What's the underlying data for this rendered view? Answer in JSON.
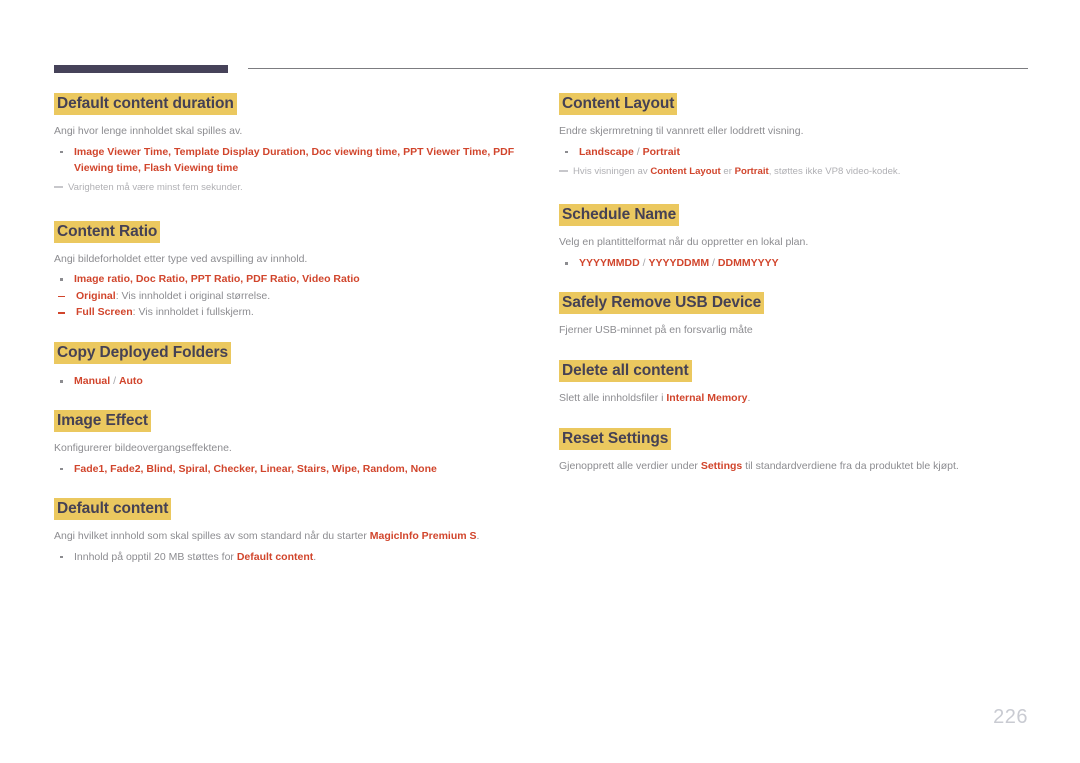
{
  "page": {
    "number": "226"
  },
  "left_column": [
    {
      "heading": "Default content duration",
      "desc": "Angi hvor lenge innholdet skal spilles av.",
      "bullet": {
        "prefix": "Image Viewer Time",
        "items": [
          "Image Viewer Time",
          "Template Display Duration",
          "Doc viewing time",
          "PPT Viewer Time",
          "PDF Viewing time",
          "Flash Viewing time"
        ],
        "text": "Image Viewer Time, Template Display Duration, Doc viewing time, PPT Viewer Time, PDF Viewing time, Flash Viewing time"
      },
      "note": "Varigheten må være minst fem sekunder."
    },
    {
      "heading": "Content Ratio",
      "desc": "Angi bildeforholdet etter type ved avspilling av innhold.",
      "bullet": {
        "items": [
          "Image ratio",
          "Doc Ratio",
          "PPT Ratio",
          "PDF Ratio",
          "Video Ratio"
        ],
        "text": "Image ratio, Doc Ratio, PPT Ratio, PDF Ratio, Video Ratio"
      },
      "subbullets": [
        {
          "term": "Original",
          "text": ": Vis innholdet i original størrelse."
        },
        {
          "term": "Full Screen",
          "text": ": Vis innholdet i fullskjerm."
        }
      ]
    },
    {
      "heading": "Copy Deployed Folders",
      "options": [
        "Manual",
        "Auto"
      ],
      "separator": "/"
    },
    {
      "heading": "Image Effect",
      "desc": "Konfigurerer bildeovergangseffektene.",
      "bullet": {
        "items": [
          "Fade1",
          "Fade2",
          "Blind",
          "Spiral",
          "Checker",
          "Linear",
          "Stairs",
          "Wipe",
          "Random",
          "None"
        ],
        "text": "Fade1, Fade2, Blind, Spiral, Checker, Linear, Stairs, Wipe, Random, None"
      }
    },
    {
      "heading": "Default content",
      "desc_before": "Angi hvilket innhold som skal spilles av som standard når du starter ",
      "desc_term": "MagicInfo Premium S",
      "desc_after": ".",
      "bullet_before": "Innhold på opptil 20 MB støttes for ",
      "bullet_term": "Default content",
      "bullet_after": "."
    }
  ],
  "right_column": [
    {
      "heading": "Content Layout",
      "desc": "Endre skjermretning til vannrett eller loddrett visning.",
      "options": [
        "Landscape",
        "Portrait"
      ],
      "separator": "/",
      "note_parts": {
        "p1": "Hvis visningen av ",
        "t1": "Content Layout",
        "p2": " er ",
        "t2": "Portrait",
        "p3": ", støttes ikke VP8 video-kodek."
      }
    },
    {
      "heading": "Schedule Name",
      "desc": "Velg en plantittelformat når du oppretter en lokal plan.",
      "options": [
        "YYYYMMDD",
        "YYYYDDMM",
        "DDMMYYYY"
      ],
      "separator": "/"
    },
    {
      "heading": "Safely Remove USB Device",
      "desc": "Fjerner USB-minnet på en forsvarlig måte"
    },
    {
      "heading": "Delete all content",
      "desc_before": "Slett alle innholdsfiler i ",
      "desc_term": "Internal Memory",
      "desc_after": "."
    },
    {
      "heading": "Reset Settings",
      "desc_before": "Gjenopprett alle verdier under ",
      "desc_term": "Settings",
      "desc_after": " til standardverdiene fra da produktet ble kjøpt."
    }
  ],
  "colors": {
    "highlight": "#ebc85f",
    "heading_text": "#454154",
    "accent_red": "#d1452c",
    "body_text": "#8c8c90",
    "rule_dark": "#464259",
    "page_number": "#c9cbd2"
  }
}
